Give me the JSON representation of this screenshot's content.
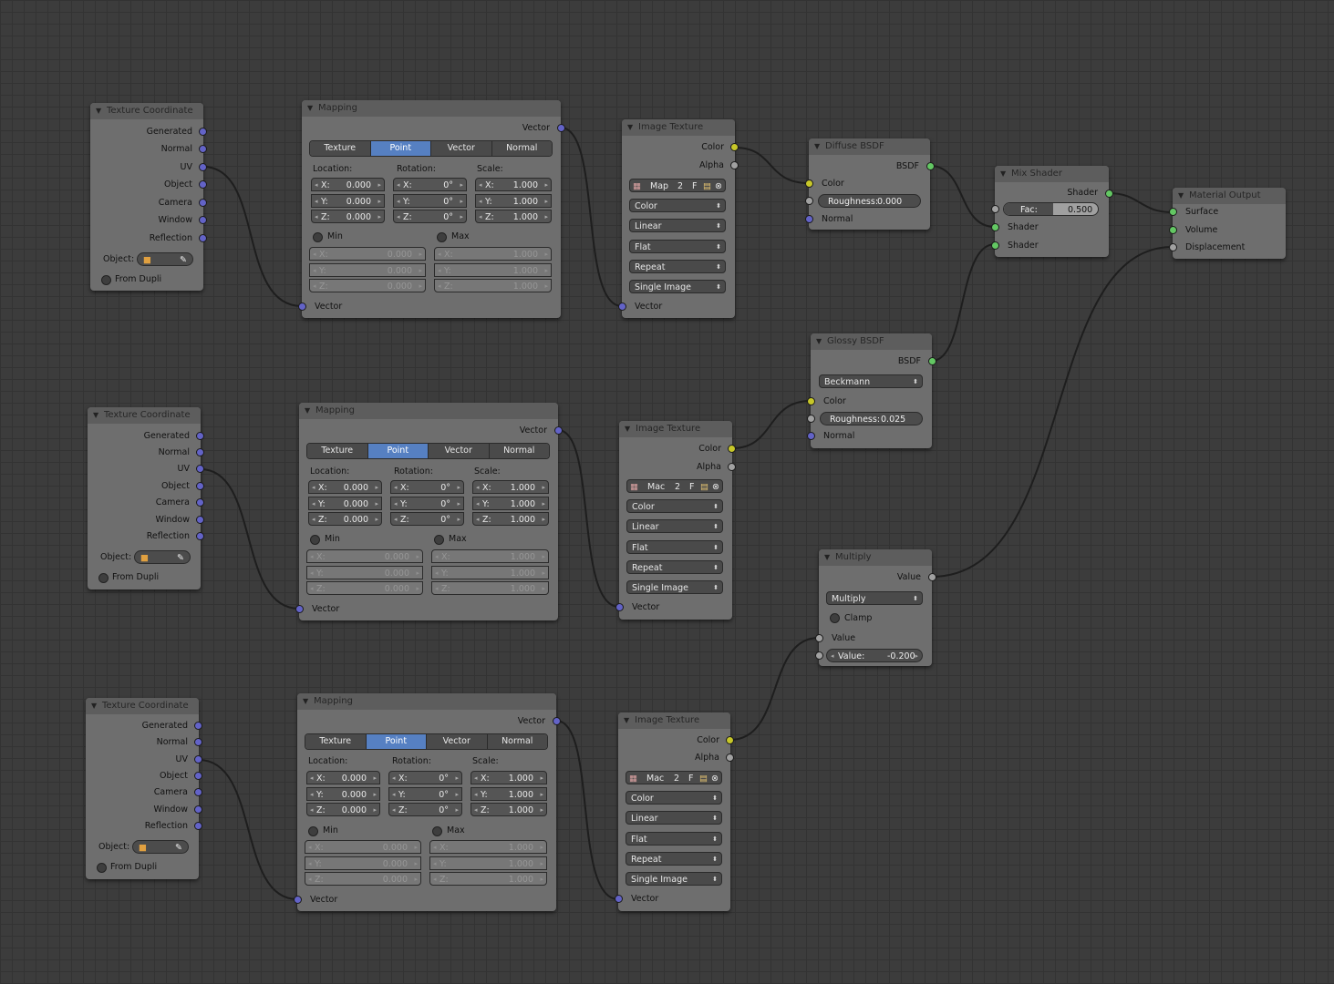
{
  "tex_coord": {
    "title": "Texture Coordinate",
    "outputs": [
      "Generated",
      "Normal",
      "UV",
      "Object",
      "Camera",
      "Window",
      "Reflection"
    ],
    "object_label": "Object:",
    "from_dupli": "From Dupli"
  },
  "mapping": {
    "title": "Mapping",
    "output": "Vector",
    "tabs": [
      "Texture",
      "Point",
      "Vector",
      "Normal"
    ],
    "active_tab": "Point",
    "location_label": "Location:",
    "rotation_label": "Rotation:",
    "scale_label": "Scale:",
    "axes": [
      "X:",
      "Y:",
      "Z:"
    ],
    "location": [
      "0.000",
      "0.000",
      "0.000"
    ],
    "rotation": [
      "0°",
      "0°",
      "0°"
    ],
    "scale": [
      "1.000",
      "1.000",
      "1.000"
    ],
    "min_label": "Min",
    "max_label": "Max",
    "min": [
      "0.000",
      "0.000",
      "0.000"
    ],
    "max": [
      "1.000",
      "1.000",
      "1.000"
    ],
    "input": "Vector"
  },
  "image_texture": {
    "title": "Image Texture",
    "outputs": [
      "Color",
      "Alpha"
    ],
    "image_name_top": "Map",
    "image_name": "Mac",
    "users": "2",
    "fake": "F",
    "dropdowns": [
      "Color",
      "Linear",
      "Flat",
      "Repeat",
      "Single Image"
    ],
    "input": "Vector"
  },
  "diffuse": {
    "title": "Diffuse BSDF",
    "output": "BSDF",
    "inputs": [
      "Color",
      "Normal"
    ],
    "roughness_label": "Roughness:",
    "roughness": "0.000"
  },
  "glossy": {
    "title": "Glossy BSDF",
    "output": "BSDF",
    "distribution": "Beckmann",
    "inputs": [
      "Color",
      "Normal"
    ],
    "roughness_label": "Roughness:",
    "roughness": "0.025"
  },
  "mix": {
    "title": "Mix Shader",
    "output": "Shader",
    "fac_label": "Fac:",
    "fac": "0.500",
    "inputs": [
      "Shader",
      "Shader"
    ]
  },
  "material_output": {
    "title": "Material Output",
    "inputs": [
      "Surface",
      "Volume",
      "Displacement"
    ]
  },
  "math": {
    "title": "Multiply",
    "output": "Value",
    "operation": "Multiply",
    "clamp": "Clamp",
    "input1": "Value",
    "value_label": "Value:",
    "value": "-0.200"
  },
  "colors": {
    "background": "#3c3c3c",
    "node_body": "#6e6e6e",
    "vector_socket": "#6363c7",
    "color_socket": "#c7c729",
    "shader_socket": "#63c763",
    "value_socket": "#a1a1a1",
    "active_tab": "#5680c2"
  }
}
